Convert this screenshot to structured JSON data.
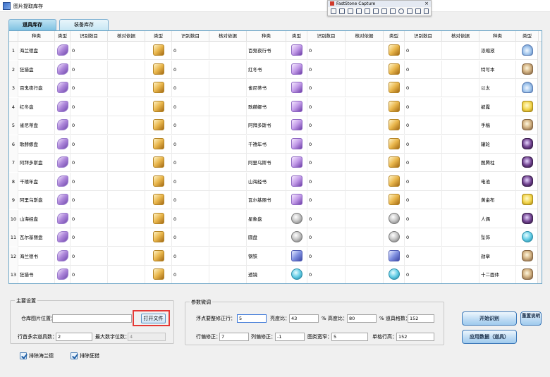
{
  "window": {
    "title": "图片提取库存"
  },
  "faststone": {
    "title": "FastStone Capture",
    "close_label": "×"
  },
  "tabs": [
    {
      "label": "道具库存"
    },
    {
      "label": "装备库存"
    }
  ],
  "grid": {
    "headers": [
      "种类",
      "类型",
      "识别数目",
      "核对依据"
    ],
    "rows": [
      {
        "num": "1",
        "c1": "海兰德盘",
        "c2": "0",
        "c3": "0",
        "c4": "百鬼夜行书",
        "c5": "0",
        "c6": "0",
        "c7": "浓缩液"
      },
      {
        "num": "2",
        "c1": "狂猎盘",
        "c2": "0",
        "c3": "0",
        "c4": "红冬书",
        "c5": "0",
        "c6": "0",
        "c7": "特写本"
      },
      {
        "num": "3",
        "c1": "百鬼夜行盘",
        "c2": "0",
        "c3": "0",
        "c4": "雀尼蒂书",
        "c5": "0",
        "c6": "0",
        "c7": "以太"
      },
      {
        "num": "4",
        "c1": "红冬盘",
        "c2": "0",
        "c3": "0",
        "c4": "歌赫娜书",
        "c5": "0",
        "c6": "0",
        "c7": "披露"
      },
      {
        "num": "5",
        "c1": "雀尼蒂盘",
        "c2": "0",
        "c3": "0",
        "c4": "阿拜多斯书",
        "c5": "0",
        "c6": "0",
        "c7": "手稿"
      },
      {
        "num": "6",
        "c1": "歌赫娜盘",
        "c2": "0",
        "c3": "0",
        "c4": "千禧年书",
        "c5": "0",
        "c6": "0",
        "c7": "罐轮"
      },
      {
        "num": "7",
        "c1": "阿拜多斯盘",
        "c2": "0",
        "c3": "0",
        "c4": "阿里乌斯书",
        "c5": "0",
        "c6": "0",
        "c7": "图腾柱"
      },
      {
        "num": "8",
        "c1": "千禧年盘",
        "c2": "0",
        "c3": "0",
        "c4": "山海经书",
        "c5": "0",
        "c6": "0",
        "c7": "电池"
      },
      {
        "num": "9",
        "c1": "阿里乌斯盘",
        "c2": "0",
        "c3": "0",
        "c4": "瓦尔基丽书",
        "c5": "0",
        "c6": "0",
        "c7": "黄金布"
      },
      {
        "num": "10",
        "c1": "山海经盘",
        "c2": "0",
        "c3": "0",
        "c4": "星象盘",
        "c5": "0",
        "c6": "0",
        "c7": "人偶"
      },
      {
        "num": "11",
        "c1": "瓦尔基丽盘",
        "c2": "0",
        "c3": "0",
        "c4": "圆盘",
        "c5": "0",
        "c6": "0",
        "c7": "坠饰"
      },
      {
        "num": "12",
        "c1": "海兰德书",
        "c2": "0",
        "c3": "0",
        "c4": "钢铁",
        "c5": "0",
        "c6": "0",
        "c7": "勋章"
      },
      {
        "num": "13",
        "c1": "狂猎书",
        "c2": "0",
        "c3": "0",
        "c4": "透镜",
        "c5": "0",
        "c6": "0",
        "c7": "十二面体"
      }
    ]
  },
  "main_settings": {
    "title": "主要设置",
    "image_location_label": "仓库图片位置：",
    "image_location_value": "",
    "open_file_label": "打开文件",
    "items_per_row_label": "行首多余道具数：",
    "items_per_row_value": "2",
    "max_digits_label": "最大数字位数：",
    "max_digits_value": "4",
    "exclude_highlander_label": "排除海兰德",
    "exclude_wildhunt_label": "排除狂猎"
  },
  "params": {
    "title": "参数微调",
    "float_correction_label": "浮点要整修正行：",
    "float_correction_value": "5",
    "brightness_label": "亮度比：",
    "brightness_value": "43",
    "height_ratio_label": "% 高度比：",
    "height_ratio_value": "80",
    "grid_count_label": "% 道具格数：",
    "grid_count_value": "152",
    "row_correction_label": "行偏修正：",
    "row_correction_value": "7",
    "col_correction_label": "列偏修正：",
    "col_correction_value": "-1",
    "image_width_label": "图类宽窄：",
    "image_width_value": "5",
    "cell_height_label": "单格行高：",
    "cell_height_value": "152"
  },
  "actions": {
    "start_label": "开始识别",
    "reset_label": "重置说明",
    "apply_label": "应用数据（道具）"
  },
  "colors": {
    "accent": "#3c78b8",
    "highlight_box": "#e53935",
    "tab_active": "#7fc2e2"
  }
}
